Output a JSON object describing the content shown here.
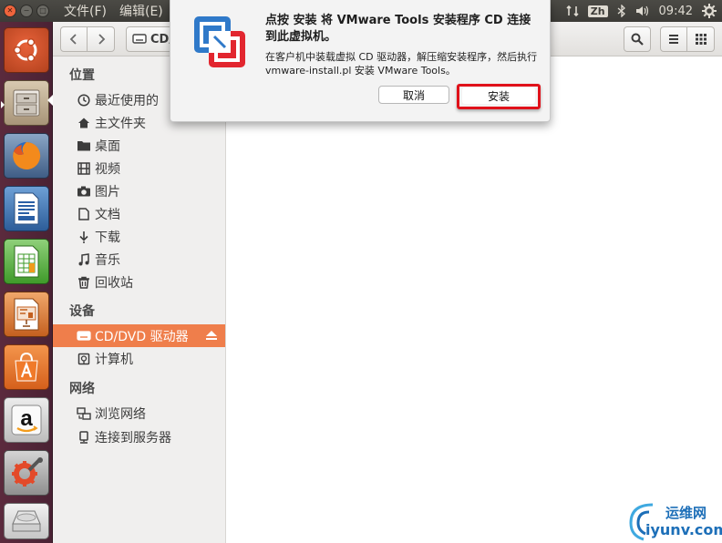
{
  "top_panel": {
    "menu": [
      "文件(F)",
      "编辑(E)"
    ],
    "input_method": "Zh",
    "clock": "09:42"
  },
  "toolbar": {
    "location_label": "CD/"
  },
  "sidebar": {
    "places_heading": "位置",
    "places": [
      "最近使用的",
      "主文件夹",
      "桌面",
      "视频",
      "图片",
      "文档",
      "下载",
      "音乐",
      "回收站"
    ],
    "devices_heading": "设备",
    "devices": [
      "CD/DVD 驱动器",
      "计算机"
    ],
    "network_heading": "网络",
    "network": [
      "浏览网络",
      "连接到服务器"
    ]
  },
  "dialog": {
    "title": "点按 安装 将 VMware Tools 安装程序 CD 连接到此虚拟机。",
    "description": "在客户机中装载虚拟 CD 驱动器，解压缩安装程序，然后执行 vmware-install.pl 安装 VMware Tools。",
    "cancel_label": "取消",
    "install_label": "安装"
  },
  "watermark": {
    "cn": "运维网",
    "en": "iyunv.com"
  },
  "colors": {
    "selection": "#ef7e4b",
    "launcher": "#5b2a3d",
    "highlight": "#e0111a"
  }
}
